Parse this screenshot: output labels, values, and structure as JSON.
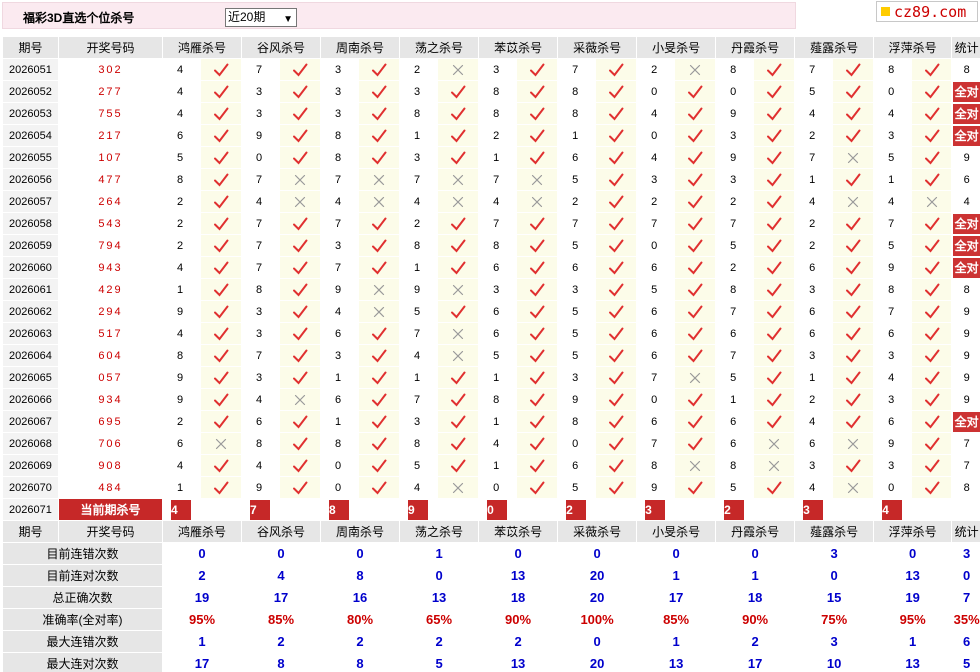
{
  "header": {
    "title": "福彩3D直选个位杀号",
    "period_select": "近20期",
    "logo": "cz89.com"
  },
  "columns": [
    "期号",
    "开奖号码",
    "鸿雁杀号",
    "谷风杀号",
    "周南杀号",
    "荡之杀号",
    "苯苡杀号",
    "采薇杀号",
    "小旻杀号",
    "丹霞杀号",
    "薤露杀号",
    "浮萍杀号",
    "统计"
  ],
  "rows": [
    {
      "period": "2026051",
      "numbers": "302",
      "kills": [
        4,
        7,
        3,
        2,
        3,
        7,
        2,
        8,
        7,
        8
      ],
      "ok": [
        1,
        1,
        1,
        0,
        1,
        1,
        0,
        1,
        1,
        1
      ],
      "stat": "8"
    },
    {
      "period": "2026052",
      "numbers": "277",
      "kills": [
        4,
        3,
        3,
        3,
        8,
        8,
        0,
        0,
        5,
        0
      ],
      "ok": [
        1,
        1,
        1,
        1,
        1,
        1,
        1,
        1,
        1,
        1
      ],
      "stat": "全对"
    },
    {
      "period": "2026053",
      "numbers": "755",
      "kills": [
        4,
        3,
        3,
        8,
        8,
        8,
        4,
        9,
        4,
        4
      ],
      "ok": [
        1,
        1,
        1,
        1,
        1,
        1,
        1,
        1,
        1,
        1
      ],
      "stat": "全对"
    },
    {
      "period": "2026054",
      "numbers": "217",
      "kills": [
        6,
        9,
        8,
        1,
        2,
        1,
        0,
        3,
        2,
        3
      ],
      "ok": [
        1,
        1,
        1,
        1,
        1,
        1,
        1,
        1,
        1,
        1
      ],
      "stat": "全对"
    },
    {
      "period": "2026055",
      "numbers": "107",
      "kills": [
        5,
        0,
        8,
        3,
        1,
        6,
        4,
        9,
        7,
        5
      ],
      "ok": [
        1,
        1,
        1,
        1,
        1,
        1,
        1,
        1,
        0,
        1
      ],
      "stat": "9"
    },
    {
      "period": "2026056",
      "numbers": "477",
      "kills": [
        8,
        7,
        7,
        7,
        7,
        5,
        3,
        3,
        1,
        1
      ],
      "ok": [
        1,
        0,
        0,
        0,
        0,
        1,
        1,
        1,
        1,
        1
      ],
      "stat": "6"
    },
    {
      "period": "2026057",
      "numbers": "264",
      "kills": [
        2,
        4,
        4,
        4,
        4,
        2,
        2,
        2,
        4,
        4
      ],
      "ok": [
        1,
        0,
        0,
        0,
        0,
        1,
        1,
        1,
        0,
        0
      ],
      "stat": "4"
    },
    {
      "period": "2026058",
      "numbers": "543",
      "kills": [
        2,
        7,
        7,
        2,
        7,
        7,
        7,
        7,
        2,
        7
      ],
      "ok": [
        1,
        1,
        1,
        1,
        1,
        1,
        1,
        1,
        1,
        1
      ],
      "stat": "全对"
    },
    {
      "period": "2026059",
      "numbers": "794",
      "kills": [
        2,
        7,
        3,
        8,
        8,
        5,
        0,
        5,
        2,
        5
      ],
      "ok": [
        1,
        1,
        1,
        1,
        1,
        1,
        1,
        1,
        1,
        1
      ],
      "stat": "全对"
    },
    {
      "period": "2026060",
      "numbers": "943",
      "kills": [
        4,
        7,
        7,
        1,
        6,
        6,
        6,
        2,
        6,
        9
      ],
      "ok": [
        1,
        1,
        1,
        1,
        1,
        1,
        1,
        1,
        1,
        1
      ],
      "stat": "全对"
    },
    {
      "period": "2026061",
      "numbers": "429",
      "kills": [
        1,
        8,
        9,
        9,
        3,
        3,
        5,
        8,
        3,
        8
      ],
      "ok": [
        1,
        1,
        0,
        0,
        1,
        1,
        1,
        1,
        1,
        1
      ],
      "stat": "8"
    },
    {
      "period": "2026062",
      "numbers": "294",
      "kills": [
        9,
        3,
        4,
        5,
        6,
        5,
        6,
        7,
        6,
        7
      ],
      "ok": [
        1,
        1,
        0,
        1,
        1,
        1,
        1,
        1,
        1,
        1
      ],
      "stat": "9"
    },
    {
      "period": "2026063",
      "numbers": "517",
      "kills": [
        4,
        3,
        6,
        7,
        6,
        5,
        6,
        6,
        6,
        6
      ],
      "ok": [
        1,
        1,
        1,
        0,
        1,
        1,
        1,
        1,
        1,
        1
      ],
      "stat": "9"
    },
    {
      "period": "2026064",
      "numbers": "604",
      "kills": [
        8,
        7,
        3,
        4,
        5,
        5,
        6,
        7,
        3,
        3
      ],
      "ok": [
        1,
        1,
        1,
        0,
        1,
        1,
        1,
        1,
        1,
        1
      ],
      "stat": "9"
    },
    {
      "period": "2026065",
      "numbers": "057",
      "kills": [
        9,
        3,
        1,
        1,
        1,
        3,
        7,
        5,
        1,
        4
      ],
      "ok": [
        1,
        1,
        1,
        1,
        1,
        1,
        0,
        1,
        1,
        1
      ],
      "stat": "9"
    },
    {
      "period": "2026066",
      "numbers": "934",
      "kills": [
        9,
        4,
        6,
        7,
        8,
        9,
        0,
        1,
        2,
        3
      ],
      "ok": [
        1,
        0,
        1,
        1,
        1,
        1,
        1,
        1,
        1,
        1
      ],
      "stat": "9"
    },
    {
      "period": "2026067",
      "numbers": "695",
      "kills": [
        2,
        6,
        1,
        3,
        1,
        8,
        6,
        6,
        4,
        6
      ],
      "ok": [
        1,
        1,
        1,
        1,
        1,
        1,
        1,
        1,
        1,
        1
      ],
      "stat": "全对"
    },
    {
      "period": "2026068",
      "numbers": "706",
      "kills": [
        6,
        8,
        8,
        8,
        4,
        0,
        7,
        6,
        6,
        9
      ],
      "ok": [
        0,
        1,
        1,
        1,
        1,
        1,
        1,
        0,
        0,
        1
      ],
      "stat": "7"
    },
    {
      "period": "2026069",
      "numbers": "908",
      "kills": [
        4,
        4,
        0,
        5,
        1,
        6,
        8,
        8,
        3,
        3
      ],
      "ok": [
        1,
        1,
        1,
        1,
        1,
        1,
        0,
        0,
        1,
        1
      ],
      "stat": "7"
    },
    {
      "period": "2026070",
      "numbers": "484",
      "kills": [
        1,
        9,
        0,
        4,
        0,
        5,
        9,
        5,
        4,
        0
      ],
      "ok": [
        1,
        1,
        1,
        0,
        1,
        1,
        1,
        1,
        0,
        1
      ],
      "stat": "8"
    }
  ],
  "current": {
    "period": "2026071",
    "label": "当前期杀号",
    "kills": [
      "4",
      "7",
      "8",
      "9",
      "0",
      "2",
      "3",
      "2",
      "3",
      "4"
    ]
  },
  "stats_header": [
    "期号",
    "开奖号码",
    "鸿雁杀号",
    "谷风杀号",
    "周南杀号",
    "荡之杀号",
    "苯苡杀号",
    "采薇杀号",
    "小旻杀号",
    "丹霞杀号",
    "薤露杀号",
    "浮萍杀号",
    "统计"
  ],
  "stats": [
    {
      "label": "目前连错次数",
      "values": [
        "0",
        "0",
        "0",
        "1",
        "0",
        "0",
        "0",
        "0",
        "3",
        "0",
        "3"
      ],
      "type": "count"
    },
    {
      "label": "目前连对次数",
      "values": [
        "2",
        "4",
        "8",
        "0",
        "13",
        "20",
        "1",
        "1",
        "0",
        "13",
        "0"
      ],
      "type": "count"
    },
    {
      "label": "总正确次数",
      "values": [
        "19",
        "17",
        "16",
        "13",
        "18",
        "20",
        "17",
        "18",
        "15",
        "19",
        "7"
      ],
      "type": "count"
    },
    {
      "label": "准确率(全对率)",
      "values": [
        "95%",
        "85%",
        "80%",
        "65%",
        "90%",
        "100%",
        "85%",
        "90%",
        "75%",
        "95%",
        "35%"
      ],
      "type": "pct"
    },
    {
      "label": "最大连错次数",
      "values": [
        "1",
        "2",
        "2",
        "2",
        "2",
        "0",
        "1",
        "2",
        "3",
        "1",
        "6"
      ],
      "type": "count"
    },
    {
      "label": "最大连对次数",
      "values": [
        "17",
        "8",
        "8",
        "5",
        "13",
        "20",
        "13",
        "17",
        "10",
        "13",
        "5"
      ],
      "type": "count"
    }
  ]
}
